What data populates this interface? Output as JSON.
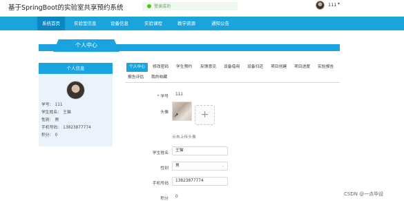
{
  "header": {
    "site_title": "基于SpringBoot的实验室共享预约系统",
    "badge_text": "登录成功",
    "user_name": "111",
    "user_caret": "▾"
  },
  "nav": {
    "items": [
      {
        "label": "系统首页"
      },
      {
        "label": "实验室信息"
      },
      {
        "label": "设备信息"
      },
      {
        "label": "实验课程"
      },
      {
        "label": "教学资源"
      },
      {
        "label": "通知公告"
      }
    ]
  },
  "page": {
    "banner_title": "个人中心"
  },
  "profile_card": {
    "title": "个人信息",
    "rows": [
      {
        "label": "学号:",
        "value": "111"
      },
      {
        "label": "学生姓名:",
        "value": "王猫"
      },
      {
        "label": "性别:",
        "value": "男"
      },
      {
        "label": "手机号码:",
        "value": "13823877774"
      },
      {
        "label": "积分:",
        "value": "0"
      }
    ]
  },
  "tabs": [
    {
      "label": "个人中心"
    },
    {
      "label": "修改密码"
    },
    {
      "label": "学生预约"
    },
    {
      "label": "反馈意见"
    },
    {
      "label": "设备借用"
    },
    {
      "label": "设备归还"
    },
    {
      "label": "项目创建"
    },
    {
      "label": "项目进度"
    },
    {
      "label": "实验报告"
    },
    {
      "label": "报告评估"
    },
    {
      "label": "我的收藏"
    }
  ],
  "form": {
    "student_no_label": "学号",
    "student_no_required": "*",
    "student_no_value": "111",
    "avatar_label": "头像",
    "upload_plus": "+",
    "upload_hint": "点击上传头像",
    "name_label": "学生姓名",
    "name_value": "王猫",
    "gender_label": "性别",
    "gender_value": "男",
    "gender_caret": "⌄",
    "phone_label": "手机号码",
    "phone_value": "13823877774",
    "points_label": "积分",
    "points_value": "0"
  },
  "watermark": "CSDN @一点毕设"
}
